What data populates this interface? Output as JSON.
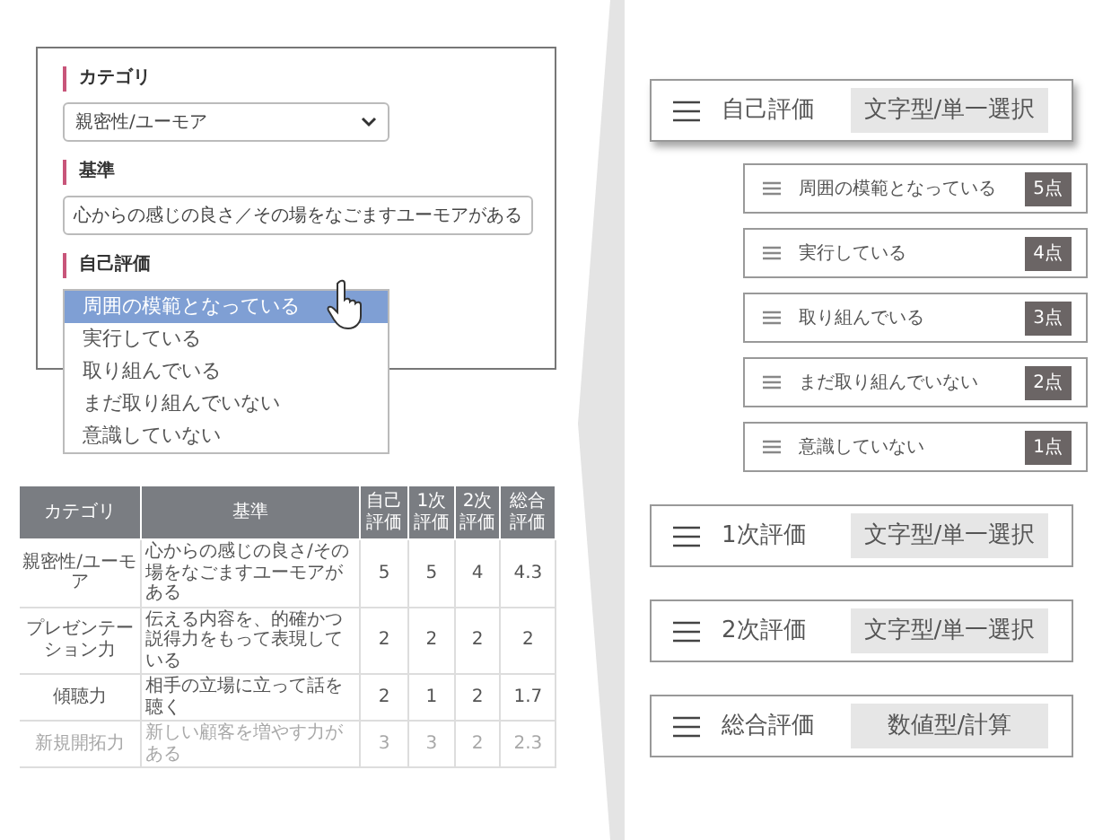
{
  "form": {
    "fields": [
      {
        "label": "カテゴリ",
        "kind": "select",
        "value": "親密性/ユーモア"
      },
      {
        "label": "基準",
        "kind": "text",
        "value": "心からの感じの良さ／その場をなごますユーモアがある"
      },
      {
        "label": "自己評価",
        "kind": "dropdown",
        "options": [
          {
            "text": "周囲の模範となっている",
            "selected": true
          },
          {
            "text": "実行している",
            "selected": false
          },
          {
            "text": "取り組んでいる",
            "selected": false
          },
          {
            "text": "まだ取り組んでいない",
            "selected": false
          },
          {
            "text": "意識していない",
            "selected": false
          }
        ]
      }
    ]
  },
  "table": {
    "columns": [
      "カテゴリ",
      "基準",
      "自己評価",
      "1次評価",
      "2次評価",
      "総合評価"
    ],
    "rows": [
      {
        "cells": [
          "親密性/ユーモア",
          "心からの感じの良さ/その場をなごますユーモアがある",
          "5",
          "5",
          "4",
          "4.3"
        ],
        "faded": false
      },
      {
        "cells": [
          "プレゼンテーション力",
          "伝える内容を、的確かつ説得力をもって表現している",
          "2",
          "2",
          "2",
          "2"
        ],
        "faded": false
      },
      {
        "cells": [
          "傾聴力",
          "相手の立場に立って話を聴く",
          "2",
          "1",
          "2",
          "1.7"
        ],
        "faded": false
      },
      {
        "cells": [
          "新規開拓力",
          "新しい顧客を増やす力がある",
          "3",
          "3",
          "2",
          "2.3"
        ],
        "faded": true
      }
    ]
  },
  "items": [
    {
      "title": "自己評価",
      "type_tag": "文字型/単一選択",
      "expanded": true,
      "options": [
        {
          "text": "周囲の模範となっている",
          "points": "5点"
        },
        {
          "text": "実行している",
          "points": "4点"
        },
        {
          "text": "取り組んでいる",
          "points": "3点"
        },
        {
          "text": "まだ取り組んでいない",
          "points": "2点"
        },
        {
          "text": "意識していない",
          "points": "1点"
        }
      ]
    },
    {
      "title": "1次評価",
      "type_tag": "文字型/単一選択",
      "expanded": false
    },
    {
      "title": "2次評価",
      "type_tag": "文字型/単一選択",
      "expanded": false
    },
    {
      "title": "総合評価",
      "type_tag": "数値型/計算",
      "expanded": false
    }
  ]
}
